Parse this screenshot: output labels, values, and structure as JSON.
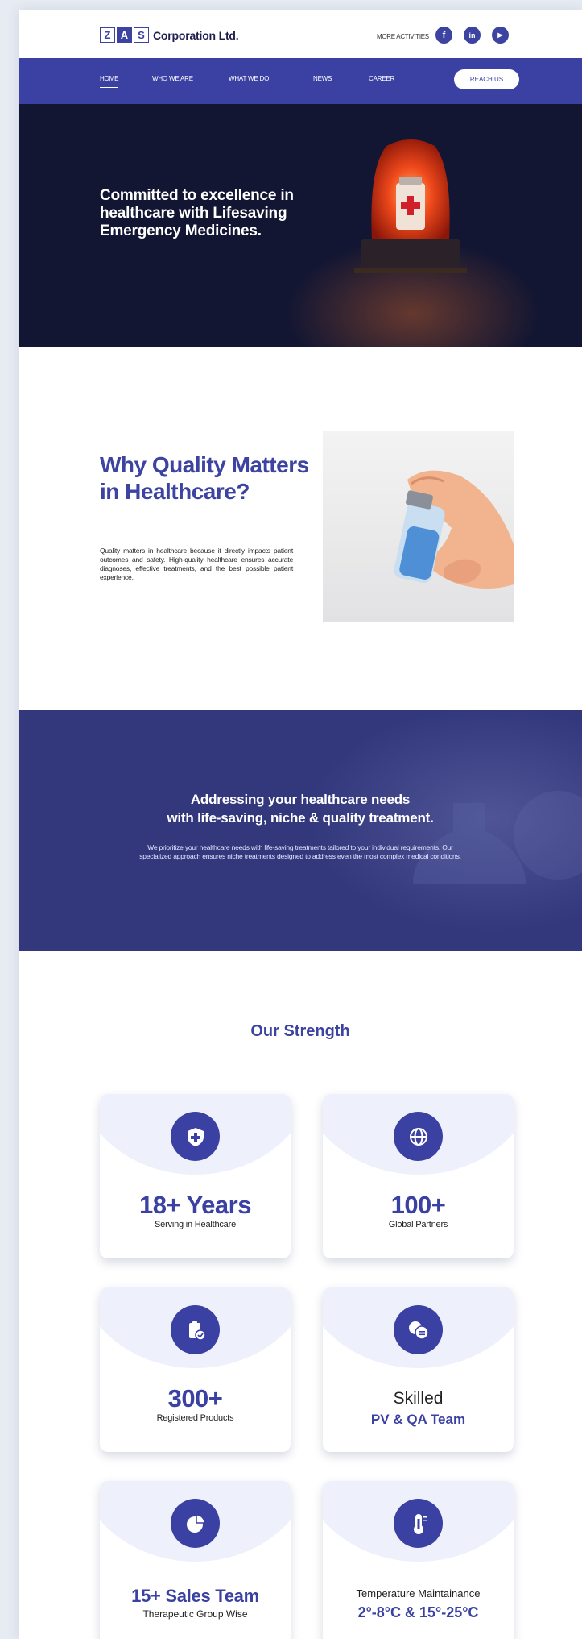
{
  "logo": {
    "letters": [
      "Z",
      "A",
      "S"
    ],
    "name": "Corporation Ltd."
  },
  "header": {
    "more_activities": "MORE ACTIVITIES",
    "social": [
      {
        "icon": "facebook-icon",
        "glyph": "f"
      },
      {
        "icon": "linkedin-icon",
        "glyph": "in"
      },
      {
        "icon": "youtube-icon",
        "glyph": "▶"
      }
    ]
  },
  "nav": {
    "items": [
      "HOME",
      "WHO WE ARE",
      "WHAT WE DO",
      "NEWS",
      "CAREER"
    ],
    "active": "HOME",
    "cta": "REACH US"
  },
  "hero": {
    "title": "Committed to excellence in healthcare with Lifesaving Emergency Medicines."
  },
  "quality": {
    "title": "Why Quality Matters in Healthcare?",
    "text": "Quality matters in healthcare because it directly impacts patient outcomes and safety. High-quality healthcare ensures accurate diagnoses, effective treatments, and the best possible patient experience."
  },
  "addressing": {
    "title_line1": "Addressing your healthcare needs",
    "title_line2": "with life-saving, niche & quality treatment.",
    "text": "We prioritize your healthcare needs with life-saving treatments tailored to your individual requirements. Our specialized approach ensures niche treatments designed to address even the most complex medical conditions."
  },
  "strength": {
    "title": "Our Strength",
    "cards": [
      {
        "icon": "shield-plus-icon",
        "big": "18+ Years",
        "small": "Serving in Healthcare"
      },
      {
        "icon": "globe-icon",
        "big": "100+",
        "small": "Global Partners"
      },
      {
        "icon": "clipboard-check-icon",
        "big": "300+",
        "small": "Registered Products"
      },
      {
        "icon": "chat-bubbles-icon",
        "line1": "Skilled",
        "line2": "PV & QA Team"
      },
      {
        "icon": "pie-chart-icon",
        "big": "15+ Sales Team",
        "small": "Therapeutic Group Wise"
      },
      {
        "icon": "thermometer-icon",
        "line1": "Temperature Maintainance",
        "line2": "2°-8°C & 15°-25°C"
      }
    ]
  },
  "colors": {
    "primary": "#3a41a2",
    "hero_bg": "#131632",
    "banner_bg": "#33387d"
  }
}
